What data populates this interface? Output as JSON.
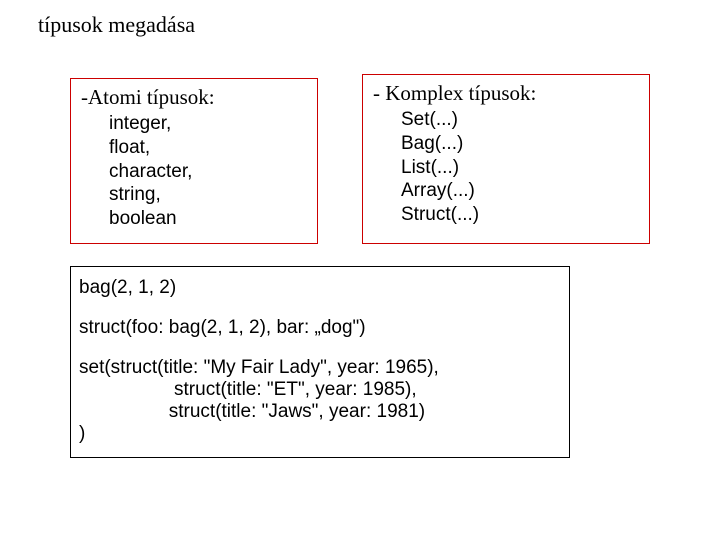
{
  "title": "típusok megadása",
  "atomic": {
    "header": "-Atomi típusok:",
    "items": [
      "integer,",
      "float,",
      "character,",
      "string,",
      "boolean"
    ]
  },
  "complex": {
    "header": "- Komplex típusok:",
    "items": [
      "Set(...)",
      "Bag(...)",
      "List(...)",
      "Array(...)",
      "Struct(...)"
    ]
  },
  "examples": {
    "line1": "bag(2, 1, 2)",
    "line2": "struct(foo: bag(2, 1, 2), bar: „dog\")",
    "line3": "set(struct(title: \"My Fair Lady\", year: 1965),\n                  struct(title: \"ET\", year: 1985),\n                 struct(title: \"Jaws\", year: 1981)\n)"
  }
}
